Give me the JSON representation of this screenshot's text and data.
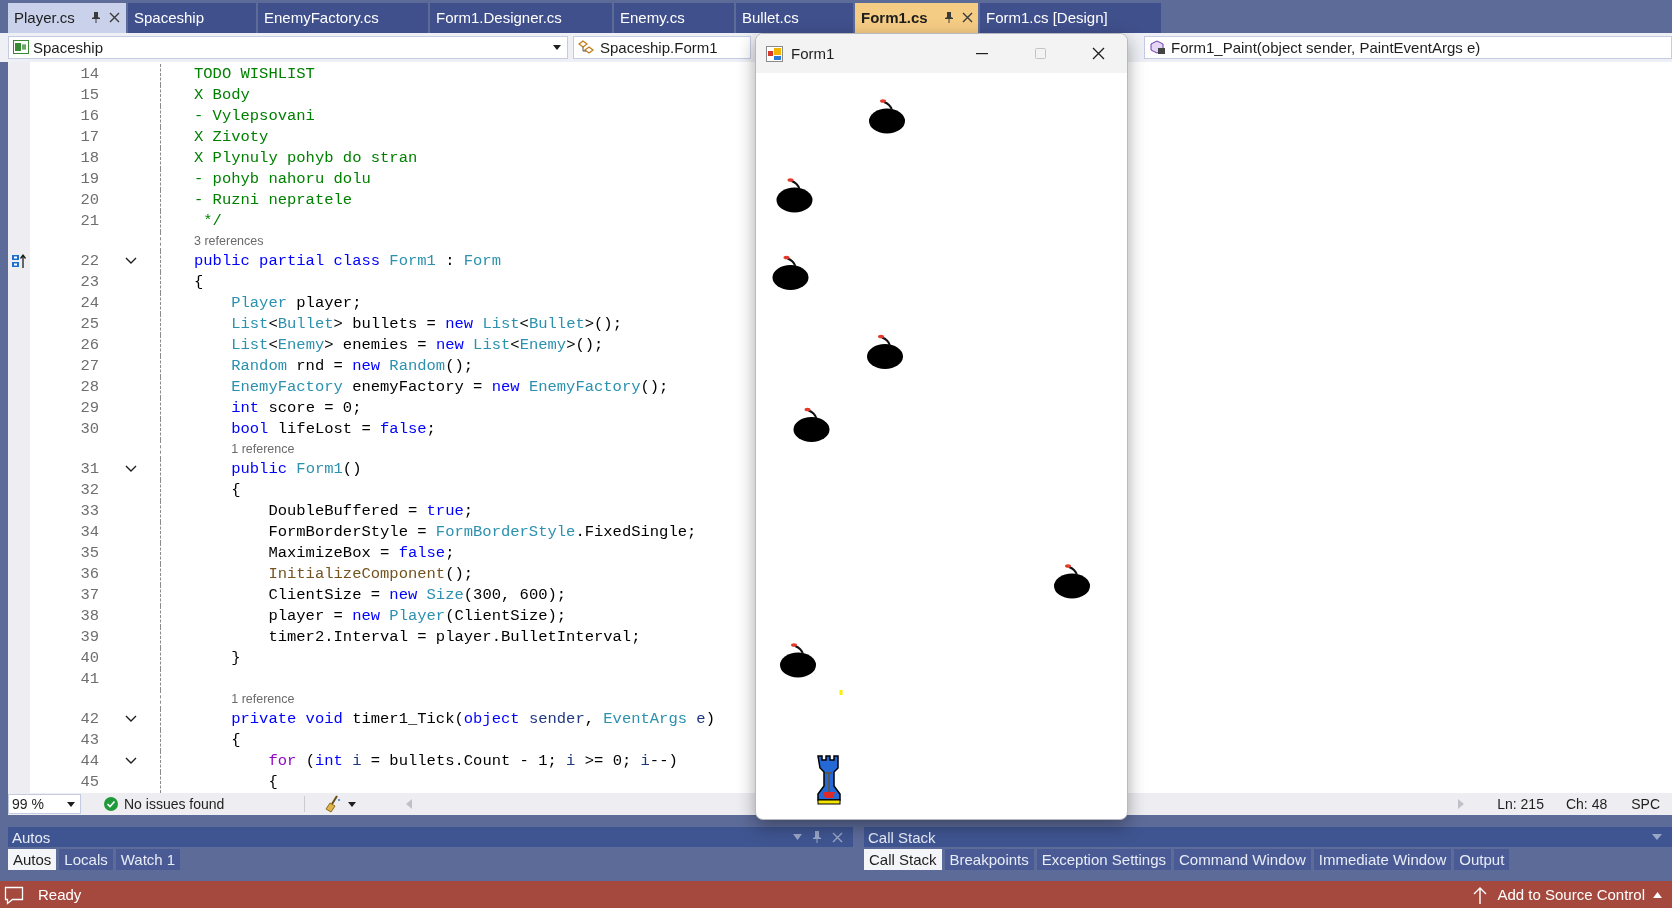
{
  "tabs": [
    {
      "label": "Player.cs",
      "selected": false,
      "pinned": true
    },
    {
      "label": "Spaceship",
      "selected": false,
      "pinned": false
    },
    {
      "label": "EnemyFactory.cs",
      "selected": false,
      "pinned": false
    },
    {
      "label": "Form1.Designer.cs",
      "selected": false,
      "pinned": false
    },
    {
      "label": "Enemy.cs",
      "selected": false,
      "pinned": false
    },
    {
      "label": "Bullet.cs",
      "selected": false,
      "pinned": false
    },
    {
      "label": "Form1.cs",
      "selected": true,
      "pinned": true
    },
    {
      "label": "Form1.cs [Design]",
      "selected": false,
      "pinned": false
    }
  ],
  "navigation": {
    "project": "Spaceship",
    "type": "Spaceship.Form1",
    "member": "Form1_Paint(object sender, PaintEventArgs e)"
  },
  "editor": {
    "lines": [
      {
        "kind": "code",
        "number": "14",
        "fold": false,
        "glyph": false,
        "segments": [
          {
            "kind": "comment",
            "text": "TODO WISHLIST"
          }
        ]
      },
      {
        "kind": "code",
        "number": "15",
        "fold": false,
        "glyph": false,
        "segments": [
          {
            "kind": "comment",
            "text": "X Body"
          }
        ]
      },
      {
        "kind": "code",
        "number": "16",
        "fold": false,
        "glyph": false,
        "segments": [
          {
            "kind": "comment",
            "text": "- Vylepsovani"
          }
        ]
      },
      {
        "kind": "code",
        "number": "17",
        "fold": false,
        "glyph": false,
        "segments": [
          {
            "kind": "comment",
            "text": "X Zivoty"
          }
        ]
      },
      {
        "kind": "code",
        "number": "18",
        "fold": false,
        "glyph": false,
        "segments": [
          {
            "kind": "comment",
            "text": "X Plynuly pohyb do stran"
          }
        ]
      },
      {
        "kind": "code",
        "number": "19",
        "fold": false,
        "glyph": false,
        "segments": [
          {
            "kind": "comment",
            "text": "- pohyb nahoru dolu"
          }
        ]
      },
      {
        "kind": "code",
        "number": "20",
        "fold": false,
        "glyph": false,
        "segments": [
          {
            "kind": "comment",
            "text": "- Ruzni nepratele"
          }
        ]
      },
      {
        "kind": "code",
        "number": "21",
        "fold": false,
        "glyph": false,
        "segments": [
          {
            "kind": "comment",
            "text": " */"
          }
        ]
      },
      {
        "kind": "codelens",
        "text": "3 references"
      },
      {
        "kind": "code",
        "number": "22",
        "fold": true,
        "glyph": true,
        "segments": [
          {
            "kind": "keyword",
            "text": "public partial class "
          },
          {
            "kind": "type",
            "text": "Form1"
          },
          {
            "kind": "plain",
            "text": " : "
          },
          {
            "kind": "type",
            "text": "Form"
          }
        ]
      },
      {
        "kind": "code",
        "number": "23",
        "fold": false,
        "glyph": false,
        "segments": [
          {
            "kind": "plain",
            "text": "{"
          }
        ]
      },
      {
        "kind": "code",
        "number": "24",
        "fold": false,
        "glyph": false,
        "segments": [
          {
            "kind": "type",
            "text": "    Player"
          },
          {
            "kind": "plain",
            "text": " player;"
          }
        ]
      },
      {
        "kind": "code",
        "number": "25",
        "fold": false,
        "glyph": false,
        "segments": [
          {
            "kind": "type",
            "text": "    List"
          },
          {
            "kind": "plain",
            "text": "<"
          },
          {
            "kind": "type",
            "text": "Bullet"
          },
          {
            "kind": "plain",
            "text": "> bullets = "
          },
          {
            "kind": "keyword",
            "text": "new "
          },
          {
            "kind": "type",
            "text": "List"
          },
          {
            "kind": "plain",
            "text": "<"
          },
          {
            "kind": "type",
            "text": "Bullet"
          },
          {
            "kind": "plain",
            "text": ">();"
          }
        ]
      },
      {
        "kind": "code",
        "number": "26",
        "fold": false,
        "glyph": false,
        "segments": [
          {
            "kind": "type",
            "text": "    List"
          },
          {
            "kind": "plain",
            "text": "<"
          },
          {
            "kind": "type",
            "text": "Enemy"
          },
          {
            "kind": "plain",
            "text": "> enemies = "
          },
          {
            "kind": "keyword",
            "text": "new "
          },
          {
            "kind": "type",
            "text": "List"
          },
          {
            "kind": "plain",
            "text": "<"
          },
          {
            "kind": "type",
            "text": "Enemy"
          },
          {
            "kind": "plain",
            "text": ">();"
          }
        ]
      },
      {
        "kind": "code",
        "number": "27",
        "fold": false,
        "glyph": false,
        "segments": [
          {
            "kind": "type",
            "text": "    Random"
          },
          {
            "kind": "plain",
            "text": " rnd = "
          },
          {
            "kind": "keyword",
            "text": "new "
          },
          {
            "kind": "type",
            "text": "Random"
          },
          {
            "kind": "plain",
            "text": "();"
          }
        ]
      },
      {
        "kind": "code",
        "number": "28",
        "fold": false,
        "glyph": false,
        "segments": [
          {
            "kind": "type",
            "text": "    EnemyFactory"
          },
          {
            "kind": "plain",
            "text": " enemyFactory = "
          },
          {
            "kind": "keyword",
            "text": "new "
          },
          {
            "kind": "type",
            "text": "EnemyFactory"
          },
          {
            "kind": "plain",
            "text": "();"
          }
        ]
      },
      {
        "kind": "code",
        "number": "29",
        "fold": false,
        "glyph": false,
        "segments": [
          {
            "kind": "keyword",
            "text": "    int"
          },
          {
            "kind": "plain",
            "text": " score = 0;"
          }
        ]
      },
      {
        "kind": "code",
        "number": "30",
        "fold": false,
        "glyph": false,
        "segments": [
          {
            "kind": "keyword",
            "text": "    bool"
          },
          {
            "kind": "plain",
            "text": " lifeLost = "
          },
          {
            "kind": "keyword",
            "text": "false"
          },
          {
            "kind": "plain",
            "text": ";"
          }
        ]
      },
      {
        "kind": "codelens",
        "text": "1 reference"
      },
      {
        "kind": "code",
        "number": "31",
        "fold": true,
        "glyph": false,
        "segments": [
          {
            "kind": "keyword",
            "text": "    public "
          },
          {
            "kind": "type",
            "text": "Form1"
          },
          {
            "kind": "plain",
            "text": "()"
          }
        ]
      },
      {
        "kind": "code",
        "number": "32",
        "fold": false,
        "glyph": false,
        "segments": [
          {
            "kind": "plain",
            "text": "    {"
          }
        ]
      },
      {
        "kind": "code",
        "number": "33",
        "fold": false,
        "glyph": false,
        "segments": [
          {
            "kind": "plain",
            "text": "        DoubleBuffered = "
          },
          {
            "kind": "keyword",
            "text": "true"
          },
          {
            "kind": "plain",
            "text": ";"
          }
        ]
      },
      {
        "kind": "code",
        "number": "34",
        "fold": false,
        "glyph": false,
        "segments": [
          {
            "kind": "plain",
            "text": "        FormBorderStyle = "
          },
          {
            "kind": "type",
            "text": "FormBorderStyle"
          },
          {
            "kind": "plain",
            "text": ".FixedSingle;"
          }
        ]
      },
      {
        "kind": "code",
        "number": "35",
        "fold": false,
        "glyph": false,
        "segments": [
          {
            "kind": "plain",
            "text": "        MaximizeBox = "
          },
          {
            "kind": "keyword",
            "text": "false"
          },
          {
            "kind": "plain",
            "text": ";"
          }
        ]
      },
      {
        "kind": "code",
        "number": "36",
        "fold": false,
        "glyph": false,
        "segments": [
          {
            "kind": "method",
            "text": "        InitializeComponent"
          },
          {
            "kind": "plain",
            "text": "();"
          }
        ]
      },
      {
        "kind": "code",
        "number": "37",
        "fold": false,
        "glyph": false,
        "segments": [
          {
            "kind": "plain",
            "text": "        ClientSize = "
          },
          {
            "kind": "keyword",
            "text": "new "
          },
          {
            "kind": "type",
            "text": "Size"
          },
          {
            "kind": "plain",
            "text": "(300, 600);"
          }
        ]
      },
      {
        "kind": "code",
        "number": "38",
        "fold": false,
        "glyph": false,
        "segments": [
          {
            "kind": "plain",
            "text": "        player = "
          },
          {
            "kind": "keyword",
            "text": "new "
          },
          {
            "kind": "type",
            "text": "Player"
          },
          {
            "kind": "plain",
            "text": "(ClientSize);"
          }
        ]
      },
      {
        "kind": "code",
        "number": "39",
        "fold": false,
        "glyph": false,
        "segments": [
          {
            "kind": "plain",
            "text": "        timer2.Interval = player.BulletInterval;"
          }
        ]
      },
      {
        "kind": "code",
        "number": "40",
        "fold": false,
        "glyph": false,
        "segments": [
          {
            "kind": "plain",
            "text": "    }"
          }
        ]
      },
      {
        "kind": "code",
        "number": "41",
        "fold": false,
        "glyph": false
      },
      {
        "kind": "codelens",
        "text": "1 reference"
      },
      {
        "kind": "code",
        "number": "42",
        "fold": true,
        "glyph": false,
        "segments": [
          {
            "kind": "keyword",
            "text": "    private void "
          },
          {
            "kind": "plain",
            "text": "timer1_Tick("
          },
          {
            "kind": "keyword",
            "text": "object "
          },
          {
            "kind": "param",
            "text": "sender"
          },
          {
            "kind": "plain",
            "text": ", "
          },
          {
            "kind": "type",
            "text": "EventArgs "
          },
          {
            "kind": "param",
            "text": "e"
          },
          {
            "kind": "plain",
            "text": ")"
          }
        ]
      },
      {
        "kind": "code",
        "number": "43",
        "fold": false,
        "glyph": false,
        "segments": [
          {
            "kind": "plain",
            "text": "    {"
          }
        ]
      },
      {
        "kind": "code",
        "number": "44",
        "fold": true,
        "glyph": false,
        "segments": [
          {
            "kind": "control",
            "text": "        for"
          },
          {
            "kind": "plain",
            "text": " ("
          },
          {
            "kind": "keyword",
            "text": "int "
          },
          {
            "kind": "param",
            "text": "i"
          },
          {
            "kind": "plain",
            "text": " = bullets.Count - 1; "
          },
          {
            "kind": "param",
            "text": "i"
          },
          {
            "kind": "plain",
            "text": " >= 0; "
          },
          {
            "kind": "param",
            "text": "i"
          },
          {
            "kind": "plain",
            "text": "--)"
          }
        ]
      },
      {
        "kind": "code",
        "number": "45",
        "fold": false,
        "glyph": false,
        "segments": [
          {
            "kind": "plain",
            "text": "        {"
          }
        ]
      }
    ]
  },
  "editor_status": {
    "zoom": "99 %",
    "issues": "No issues found",
    "line": "Ln: 215",
    "column": "Ch: 48",
    "whitespace": "SPC"
  },
  "panels": [
    {
      "title": "Autos",
      "tabs": [
        {
          "label": "Autos",
          "selected": true
        },
        {
          "label": "Locals",
          "selected": false
        },
        {
          "label": "Watch 1",
          "selected": false
        }
      ]
    },
    {
      "title": "Call Stack",
      "tabs": [
        {
          "label": "Call Stack",
          "selected": true
        },
        {
          "label": "Breakpoints",
          "selected": false
        },
        {
          "label": "Exception Settings",
          "selected": false
        },
        {
          "label": "Command Window",
          "selected": false
        },
        {
          "label": "Immediate Window",
          "selected": false
        },
        {
          "label": "Output",
          "selected": false
        }
      ]
    }
  ],
  "status_bar": {
    "state": "Ready",
    "source_control": "Add to Source Control"
  },
  "form_window": {
    "title": "Form1",
    "maximize_disabled": true
  }
}
